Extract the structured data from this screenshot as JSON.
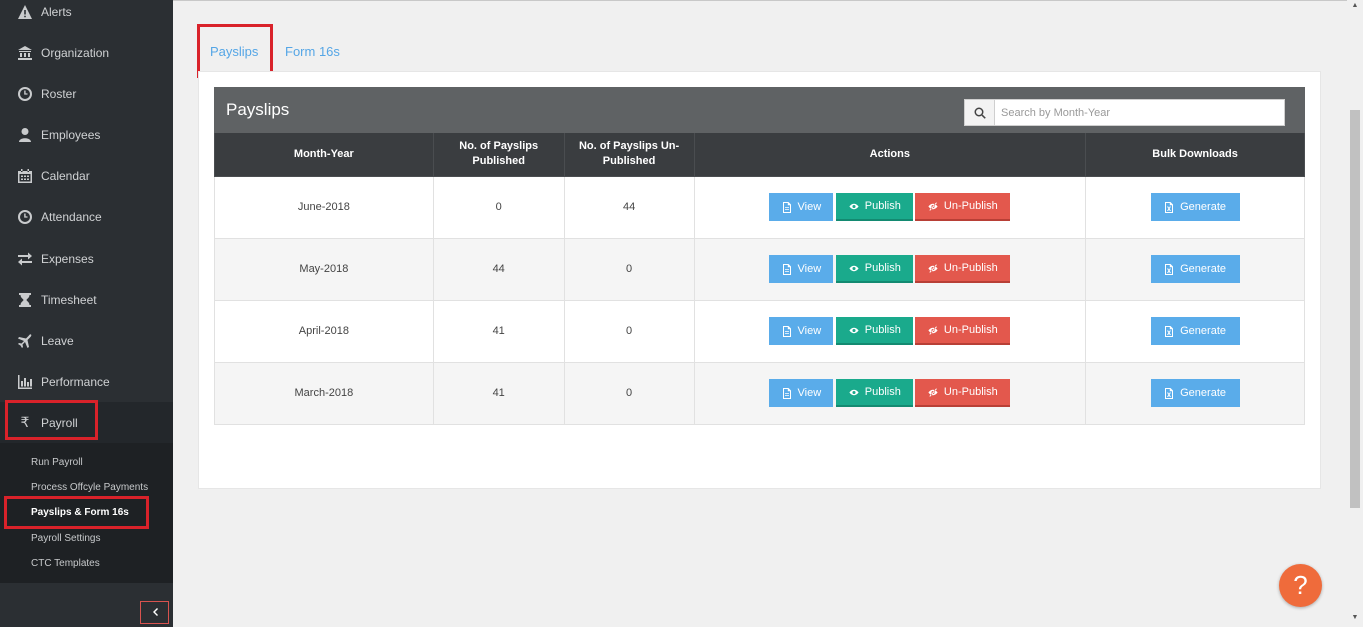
{
  "sidebar": {
    "items": [
      {
        "label": "Alerts",
        "icon": "warning-icon"
      },
      {
        "label": "Organization",
        "icon": "bank-icon"
      },
      {
        "label": "Roster",
        "icon": "clock-icon"
      },
      {
        "label": "Employees",
        "icon": "user-icon"
      },
      {
        "label": "Calendar",
        "icon": "calendar-icon"
      },
      {
        "label": "Attendance",
        "icon": "clock-icon"
      },
      {
        "label": "Expenses",
        "icon": "exchange-icon"
      },
      {
        "label": "Timesheet",
        "icon": "hourglass-icon"
      },
      {
        "label": "Leave",
        "icon": "plane-icon"
      },
      {
        "label": "Performance",
        "icon": "bar-chart-icon"
      },
      {
        "label": "Payroll",
        "icon": "rupee-icon"
      }
    ],
    "payroll_submenu": [
      {
        "label": "Run Payroll"
      },
      {
        "label": "Process Offcyle Payments"
      },
      {
        "label": "Payslips & Form 16s"
      },
      {
        "label": "Payroll Settings"
      },
      {
        "label": "CTC Templates"
      }
    ],
    "collapse_icon": "chevron-left-icon"
  },
  "tabs": [
    {
      "label": "Payslips"
    },
    {
      "label": "Form 16s"
    }
  ],
  "panel": {
    "title": "Payslips",
    "search_placeholder": "Search by Month-Year"
  },
  "table": {
    "headers": {
      "month_year": "Month-Year",
      "published": "No. of Payslips Published",
      "unpublished": "No. of Payslips Un-Published",
      "actions": "Actions",
      "bulk": "Bulk Downloads"
    },
    "buttons": {
      "view": "View",
      "publish": "Publish",
      "unpublish": "Un-Publish",
      "generate": "Generate"
    },
    "rows": [
      {
        "month_year": "June-2018",
        "published": "0",
        "unpublished": "44"
      },
      {
        "month_year": "May-2018",
        "published": "44",
        "unpublished": "0"
      },
      {
        "month_year": "April-2018",
        "published": "41",
        "unpublished": "0"
      },
      {
        "month_year": "March-2018",
        "published": "41",
        "unpublished": "0"
      }
    ]
  },
  "help_label": "?",
  "colors": {
    "sidebar_bg": "#2b2f33",
    "highlight": "#d9222a",
    "view": "#5aacea",
    "publish": "#1aaa8c",
    "unpublish": "#e3584d",
    "help": "#ef6b3b"
  }
}
